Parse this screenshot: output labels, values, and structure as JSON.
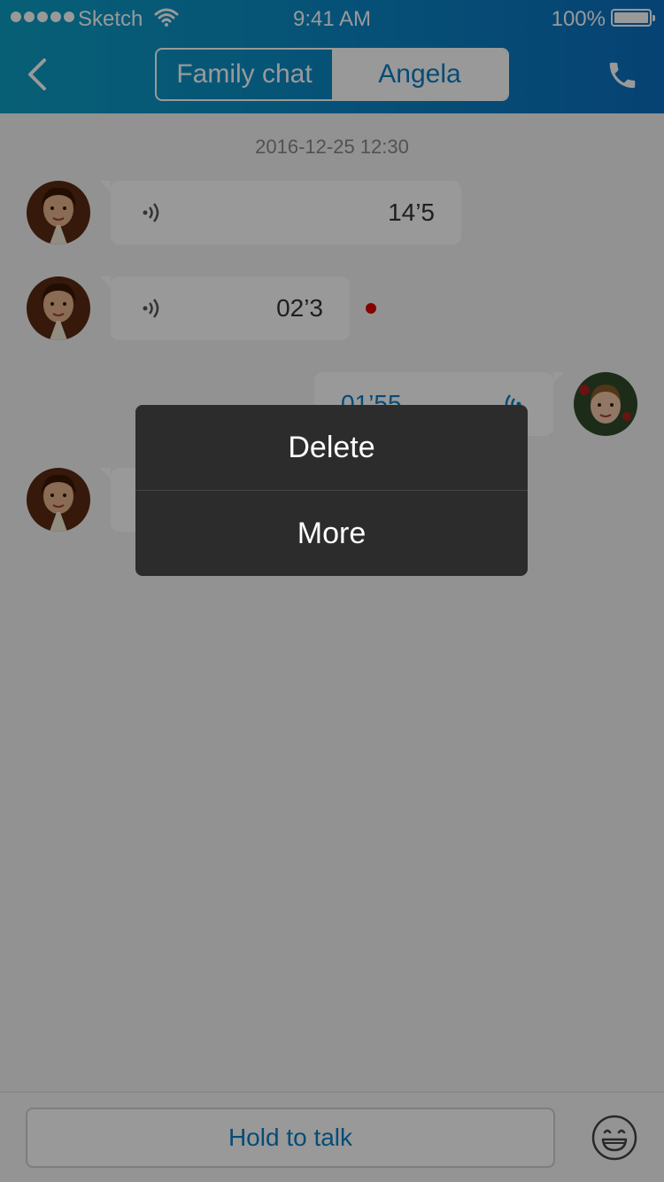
{
  "status_bar": {
    "carrier": "Sketch",
    "time": "9:41 AM",
    "battery": "100%",
    "signal_icon": "signal-dots-icon",
    "wifi_icon": "wifi-icon",
    "battery_icon": "battery-icon"
  },
  "header": {
    "back_icon": "chevron-left-icon",
    "tabs": [
      {
        "label": "Family chat",
        "selected": true
      },
      {
        "label": "Angela",
        "selected": false
      }
    ],
    "call_icon": "phone-icon"
  },
  "chat": {
    "timestamp": "2016-12-25 12:30",
    "messages": [
      {
        "direction": "incoming",
        "sender": "girl",
        "duration": "14’5",
        "unread": false
      },
      {
        "direction": "incoming",
        "sender": "girl",
        "duration": "02’3",
        "unread": true
      },
      {
        "direction": "outgoing",
        "sender": "boy",
        "duration": "01’55",
        "unread": false
      },
      {
        "direction": "incoming",
        "sender": "girl",
        "duration": "",
        "unread": false
      }
    ]
  },
  "input_bar": {
    "hold_label": "Hold to talk",
    "emoji_icon": "smiley-icon"
  },
  "context_menu": {
    "items": [
      {
        "label": "Delete"
      },
      {
        "label": "More"
      }
    ]
  },
  "colors": {
    "accent": "#0b7fc4",
    "header_start": "#0d9fc4",
    "header_end": "#0a6fc0",
    "unread_dot": "#e00000",
    "menu_bg": "#2c2c2c"
  }
}
